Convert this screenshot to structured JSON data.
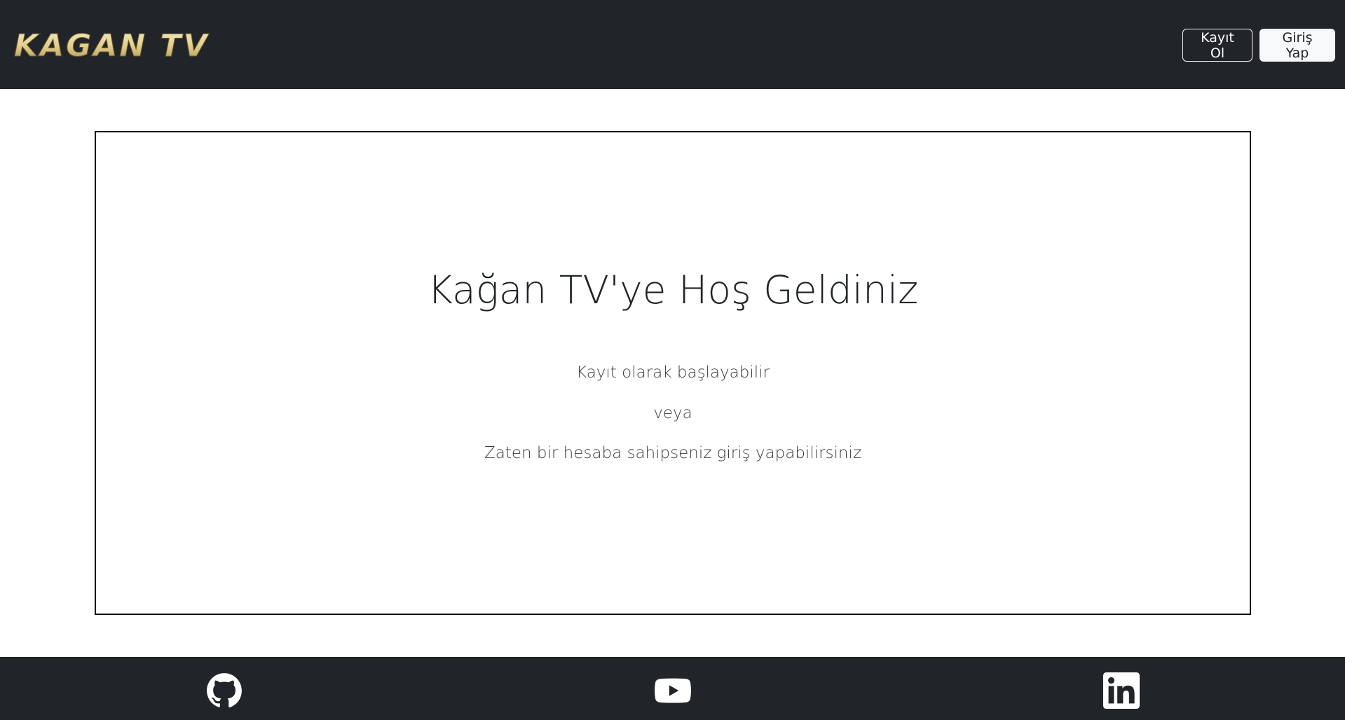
{
  "header": {
    "logo_text": "KAGAN TV",
    "register_label": "Kayıt Ol",
    "login_label": "Giriş Yap"
  },
  "hero": {
    "title": "Kağan TV'ye Hoş Geldiniz",
    "line1": "Kayıt olarak başlayabilir",
    "line2": "veya",
    "line3": "Zaten bir hesaba sahipseniz giriş yapabilirsiniz"
  },
  "footer": {
    "icons": [
      "github-icon",
      "youtube-icon",
      "linkedin-icon"
    ]
  },
  "colors": {
    "navbar_bg": "#212529",
    "logo_gold": "#e8d69a",
    "text": "#212529"
  }
}
